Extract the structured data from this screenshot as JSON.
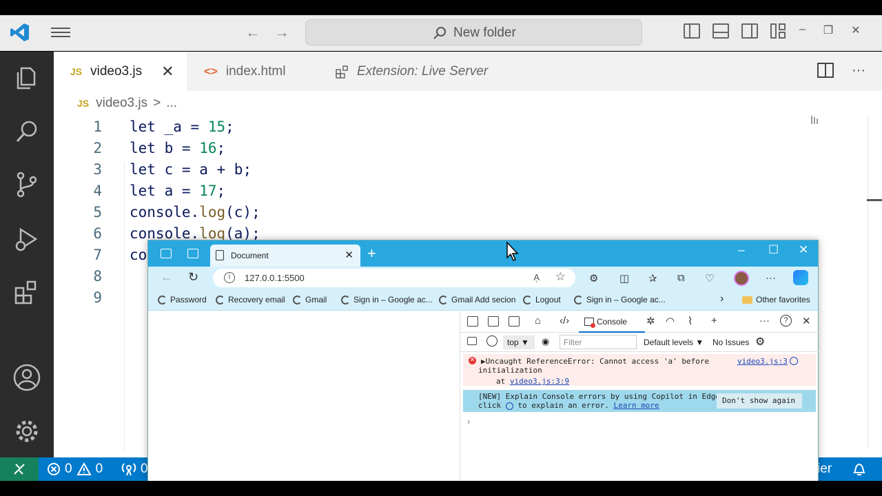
{
  "titlebar": {
    "search_placeholder": "New folder",
    "back": "←",
    "forward": "→",
    "minimize": "–",
    "restore": "❐",
    "close": "✕"
  },
  "tabs": [
    {
      "badge": "JS",
      "label": "video3.js",
      "close": "✕"
    },
    {
      "badge": "<>",
      "label": "index.html"
    },
    {
      "label": "Extension: Live Server"
    }
  ],
  "tab_actions": {
    "more": "···"
  },
  "breadcrumb": {
    "badge": "JS",
    "file": "video3.js",
    "sep": ">",
    "rest": "..."
  },
  "code": {
    "lines": [
      {
        "n": "1",
        "text": "let _a = 15;"
      },
      {
        "n": "2",
        "text": "let b = 16;"
      },
      {
        "n": "3",
        "text": "let c = a + b;"
      },
      {
        "n": "4",
        "text": "let a = 17;"
      },
      {
        "n": "5",
        "text": "console.log(c);"
      },
      {
        "n": "6",
        "text": "console.log(a);"
      },
      {
        "n": "7",
        "text": "co"
      },
      {
        "n": "8",
        "text": ""
      },
      {
        "n": "9",
        "text": ""
      }
    ]
  },
  "statusbar": {
    "errors": "0",
    "warnings": "0",
    "ports": "0",
    "right_text": "ier"
  },
  "browser": {
    "tab_title": "Document",
    "tab_close": "✕",
    "new_tab": "+",
    "minimize": "–",
    "maximize": "☐",
    "close": "✕",
    "url": "127.0.0.1:5500",
    "read_aloud": "Aͅ",
    "favorites": [
      "Password",
      "Recovery email",
      "Gmail",
      "Sign in – Google ac...",
      "Gmail Add secion",
      "Logout",
      "Sign in – Google ac..."
    ],
    "fav_chevron": "›",
    "other_favorites": "Other favorites"
  },
  "devtools": {
    "console_tab": "Console",
    "more": "···",
    "help": "?",
    "close": "✕",
    "plus": "+",
    "context": "top",
    "filter_placeholder": "Filter",
    "levels": "Default levels ▼",
    "issues": "No Issues",
    "error": {
      "line1": "▶Uncaught ReferenceError: Cannot access 'a' before",
      "line2": "initialization",
      "at": "at",
      "at_link": "video3.js:3:9",
      "source": "video3.js:3"
    },
    "info": {
      "line1": "[NEW] Explain Console errors by using Copilot in Edge:",
      "line2_a": "click",
      "line2_b": "to explain an error.",
      "learn_more": "Learn more",
      "dont_show": "Don't show again"
    },
    "prompt": "›"
  },
  "colors": {
    "activity_bar": "#2c2c2c",
    "status_bar": "#007acc",
    "remote": "#16825d",
    "browser_title": "#29a8e0",
    "accent_js": "#c3a31a"
  }
}
